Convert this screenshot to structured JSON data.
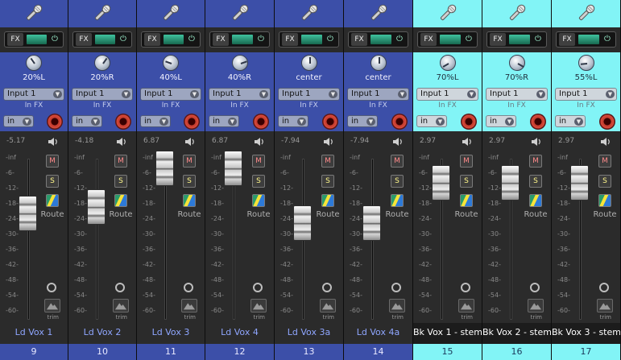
{
  "strips": [
    {
      "num": "9",
      "name": "Ld Vox 1",
      "pan": "20%L",
      "pan_deg": -35,
      "input": "Input 1",
      "infx": "In FX",
      "mon": "in",
      "vol": "-5.17",
      "fader_pos": 0.34,
      "variant": "blue"
    },
    {
      "num": "10",
      "name": "Ld Vox 2",
      "pan": "20%R",
      "pan_deg": 35,
      "input": "Input 1",
      "infx": "In FX",
      "mon": "in",
      "vol": "-4.18",
      "fader_pos": 0.3,
      "variant": "blue"
    },
    {
      "num": "11",
      "name": "Ld Vox 3",
      "pan": "40%L",
      "pan_deg": -70,
      "input": "Input 1",
      "infx": "In FX",
      "mon": "in",
      "vol": "6.87",
      "fader_pos": 0.06,
      "variant": "blue"
    },
    {
      "num": "12",
      "name": "Ld Vox 4",
      "pan": "40%R",
      "pan_deg": 70,
      "input": "Input 1",
      "infx": "In FX",
      "mon": "in",
      "vol": "6.87",
      "fader_pos": 0.06,
      "variant": "blue"
    },
    {
      "num": "13",
      "name": "Ld Vox 3a",
      "pan": "center",
      "pan_deg": 0,
      "input": "Input 1",
      "infx": "In FX",
      "mon": "in",
      "vol": "-7.94",
      "fader_pos": 0.4,
      "variant": "blue"
    },
    {
      "num": "14",
      "name": "Ld Vox 4a",
      "pan": "center",
      "pan_deg": 0,
      "input": "Input 1",
      "infx": "In FX",
      "mon": "in",
      "vol": "-7.94",
      "fader_pos": 0.4,
      "variant": "blue"
    },
    {
      "num": "15",
      "name": "Bk Vox 1 - stem",
      "pan": "70%L",
      "pan_deg": -120,
      "input": "Input 1",
      "infx": "In FX",
      "mon": "in",
      "vol": "2.97",
      "fader_pos": 0.15,
      "variant": "cyan"
    },
    {
      "num": "16",
      "name": "Bk Vox 2 - stem",
      "pan": "70%R",
      "pan_deg": 120,
      "input": "Input 1",
      "infx": "In FX",
      "mon": "in",
      "vol": "2.97",
      "fader_pos": 0.15,
      "variant": "cyan"
    },
    {
      "num": "17",
      "name": "Bk Vox 3 - stem",
      "pan": "55%L",
      "pan_deg": -95,
      "input": "Input 1",
      "infx": "In FX",
      "mon": "in",
      "vol": "2.97",
      "fader_pos": 0.15,
      "variant": "cyan"
    }
  ],
  "labels": {
    "fx": "FX",
    "mute": "M",
    "solo": "S",
    "route": "Route",
    "trim": "trim",
    "power": "⏻"
  },
  "scale": [
    "-inf",
    "-6-",
    "-12-",
    "-18-",
    "-24-",
    "-30-",
    "-36-",
    "-42-",
    "-48-",
    "-54-",
    "-60-"
  ],
  "colors": {
    "blue": "#3c4fa8",
    "cyan": "#82f4f6",
    "record": "#c0392b",
    "fx_on": "#3fc29e"
  }
}
